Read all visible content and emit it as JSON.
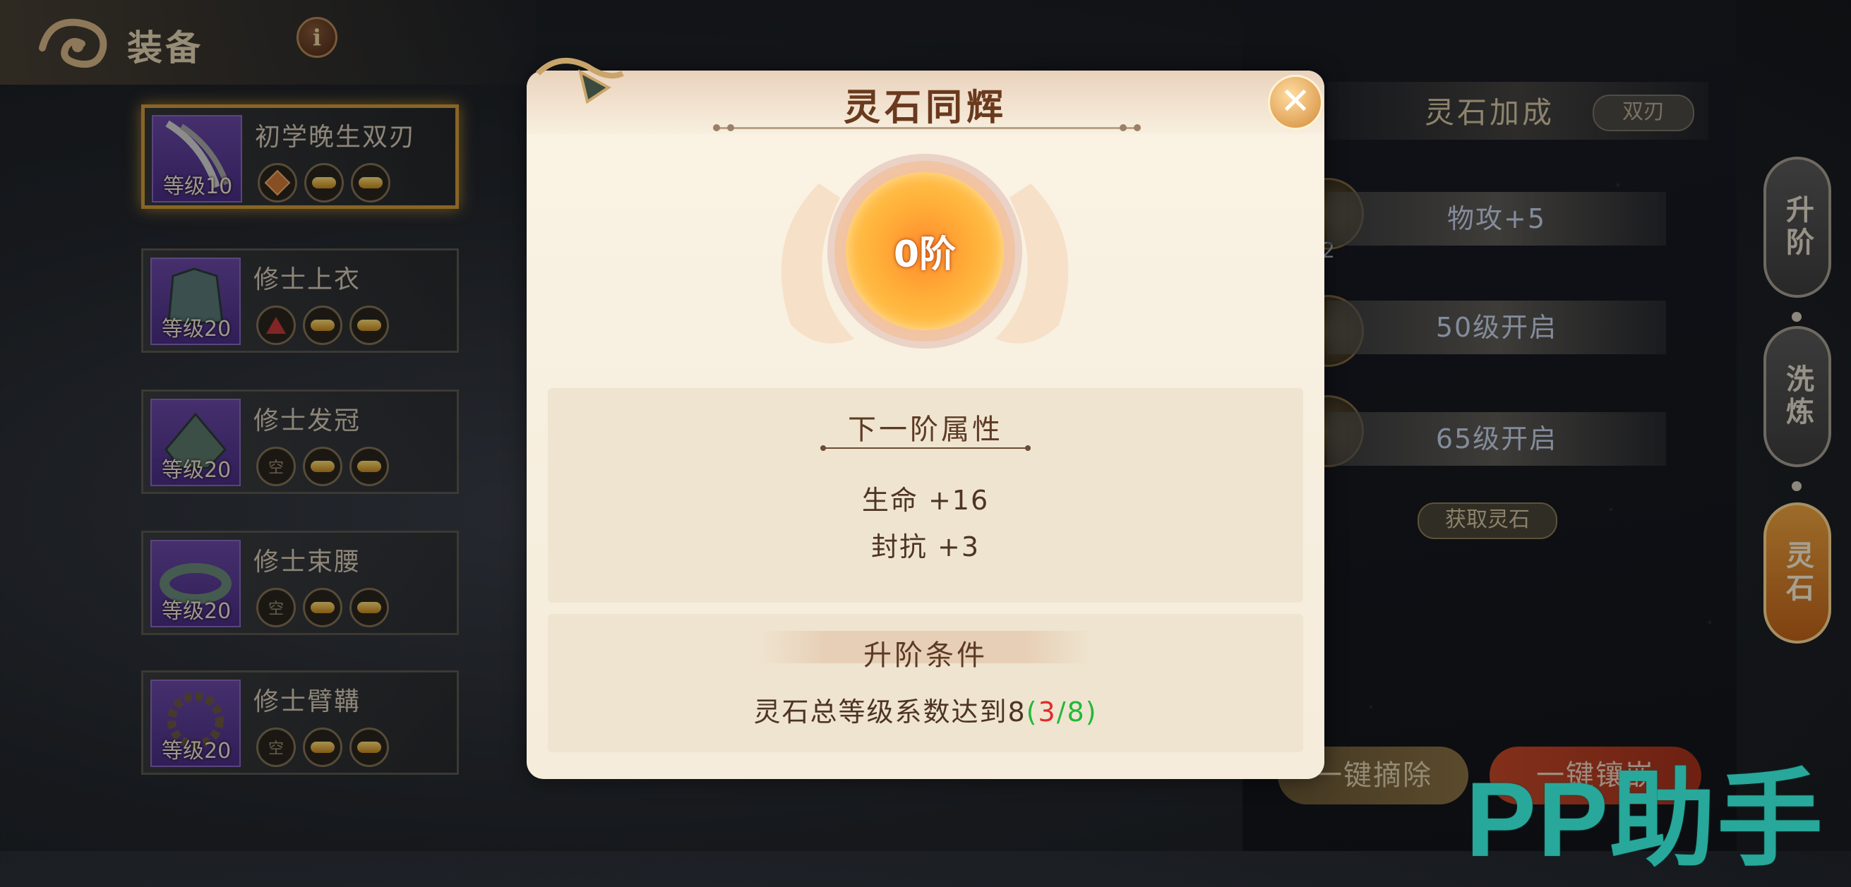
{
  "header": {
    "title": "装备",
    "info_icon": "i"
  },
  "equipment": [
    {
      "name": "初学晚生双刃",
      "level": "等级10",
      "slot1": "",
      "selected": true
    },
    {
      "name": "修士上衣",
      "level": "等级20",
      "slot1": ""
    },
    {
      "name": "修士发冠",
      "level": "等级20",
      "slot1": "空"
    },
    {
      "name": "修士束腰",
      "level": "等级20",
      "slot1": "空"
    },
    {
      "name": "修士臂鞲",
      "level": "等级20",
      "slot1": "空"
    }
  ],
  "right_panel": {
    "title": "灵石加成",
    "weapon_tag": "双刃",
    "orb_count": "2",
    "rows": [
      "物攻+5",
      "50级开启",
      "65级开启"
    ],
    "get_stone": "获取灵石",
    "side_tabs": [
      "升阶",
      "洗炼",
      "灵石"
    ],
    "active_tab": "灵石",
    "bottom_buttons": [
      "一键摘除",
      "一键镶嵌"
    ]
  },
  "dialog": {
    "title": "灵石同辉",
    "close_icon": "close-x",
    "tier": "0阶",
    "next_tier_title": "下一阶属性",
    "attributes": [
      "生命 +16",
      "封抗 +3"
    ],
    "condition_title": "升阶条件",
    "condition_text": "灵石总等级系数达到8",
    "progress_open": "(",
    "progress_current": "3",
    "progress_sep": "/",
    "progress_target": "8",
    "progress_close": ")"
  },
  "watermark": "PP助手",
  "colors": {
    "accent_orange": "#f1a640",
    "progress_red": "#e22a2a",
    "progress_green": "#23b83b",
    "title_brown": "#6a3a1e"
  }
}
